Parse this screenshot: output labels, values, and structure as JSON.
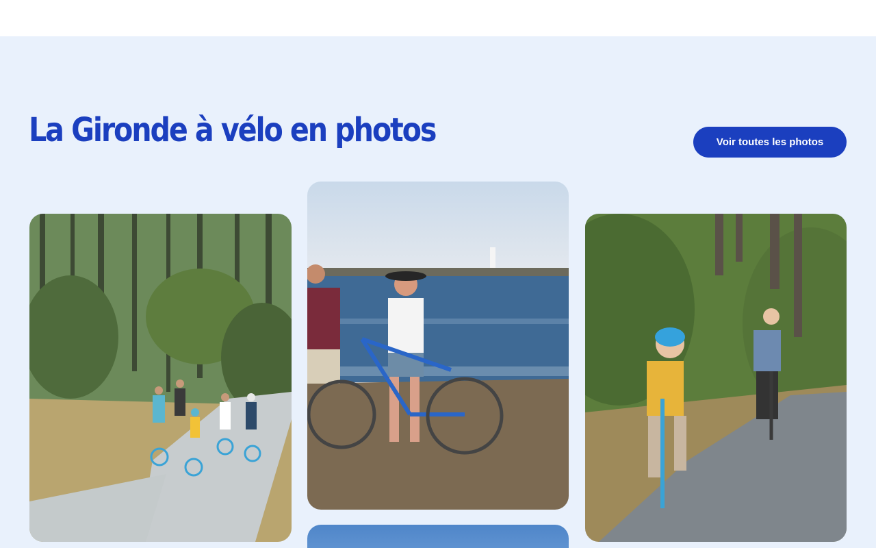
{
  "header": {},
  "gallery": {
    "title": "La Gironde à vélo en photos",
    "see_all_label": "Voir toutes les photos",
    "photos": [
      {
        "subject": "family-cycling-forest-path"
      },
      {
        "subject": "couple-with-bike-on-beach-lighthouse"
      },
      {
        "subject": "child-and-adult-cycling-pine-path"
      },
      {
        "subject": "blue-sky-photo-partial"
      }
    ]
  },
  "colors": {
    "accent": "#1b3fbf",
    "section_bg": "#e9f1fc"
  }
}
